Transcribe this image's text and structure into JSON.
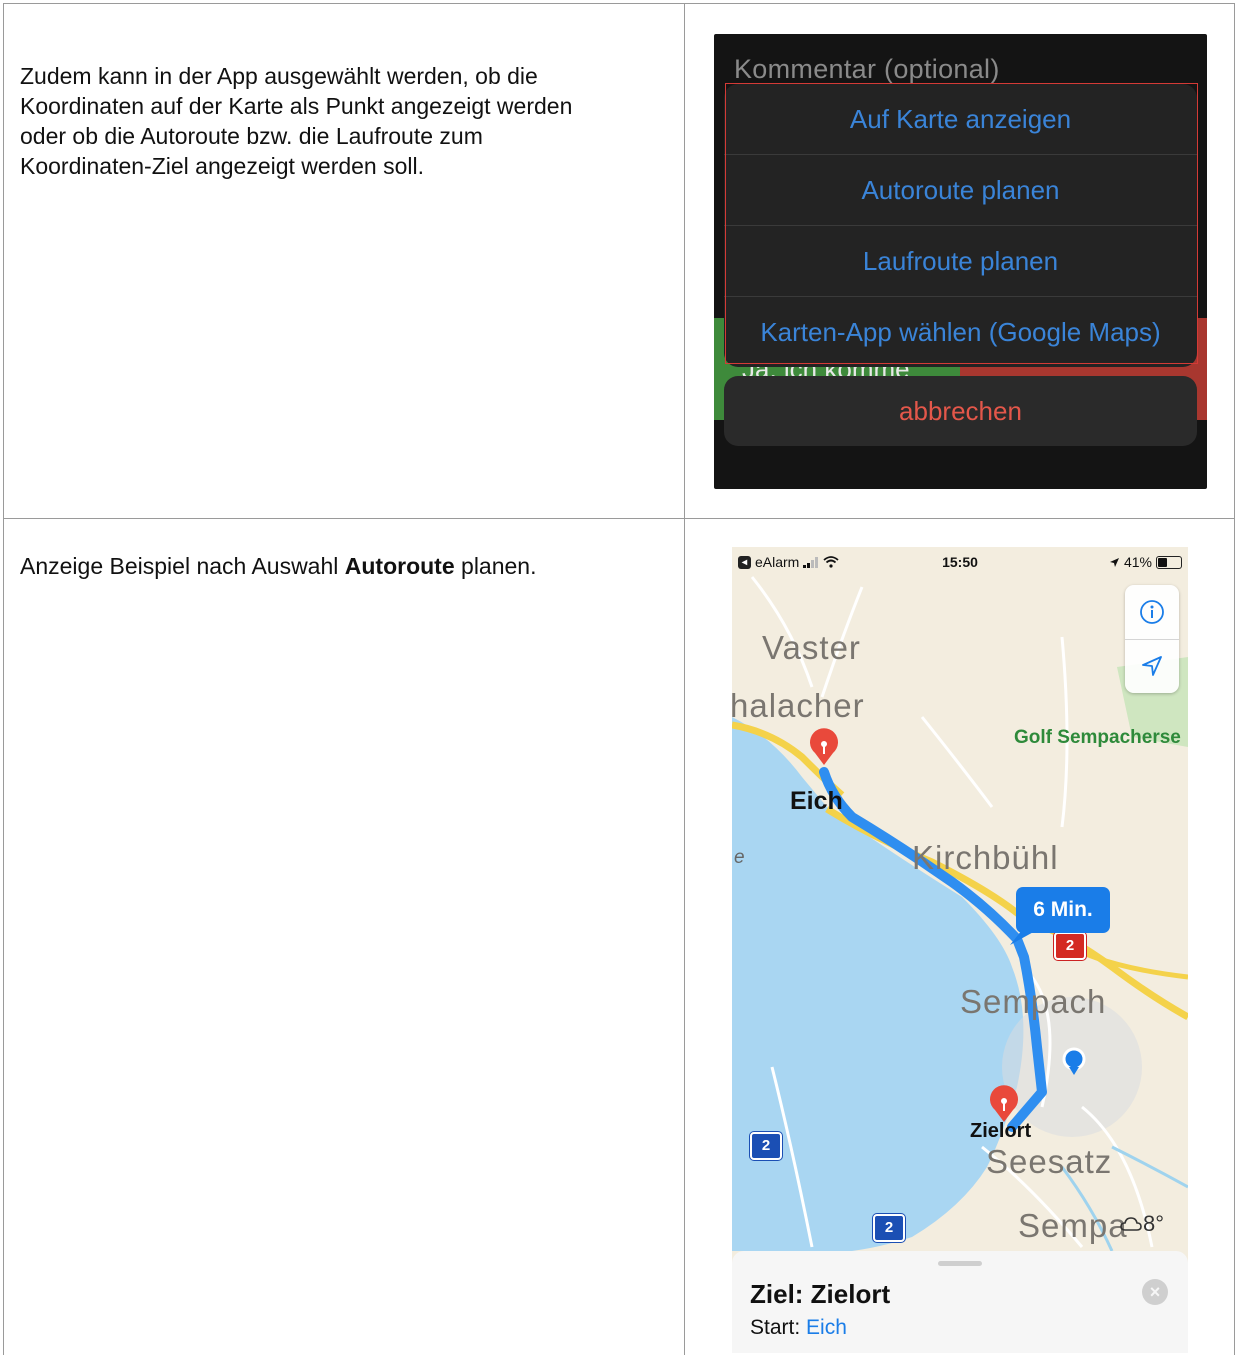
{
  "row1": {
    "description": "Zudem kann in der App ausgewählt werden, ob die Koordinaten auf der Karte als Punkt angezeigt werden oder ob die Autoroute bzw. die Laufroute zum Koordinaten-Ziel angezeigt werden soll.",
    "description_lines": [
      "Zudem kann in der App ausgewählt werden, ob die",
      "Koordinaten auf der Karte als Punkt angezeigt werden",
      "oder ob die Autoroute bzw. die Laufroute zum",
      "Koordinaten-Ziel angezeigt werden soll."
    ],
    "screenshot": {
      "comment_placeholder": "Kommentar (optional)",
      "background_button_text": "Ja, ich komme",
      "sheet_items": [
        "Auf Karte anzeigen",
        "Autoroute planen",
        "Laufroute planen",
        "Karten-App wählen (Google Maps)"
      ],
      "cancel_label": "abbrechen",
      "colors": {
        "sheet_text": "#3a84d8",
        "cancel_text": "#e4574a",
        "highlight_frame": "#d43a36"
      }
    }
  },
  "row2": {
    "text_before": "Anzeige Beispiel nach Auswahl ",
    "text_bold": "Autoroute",
    "text_after": " planen.",
    "screenshot": {
      "status_bar": {
        "carrier": "eAlarm",
        "time": "15:50",
        "battery": "41%",
        "battery_level": 0.41
      },
      "map_labels": {
        "town_1": "Vaster",
        "town_2": "halacher",
        "golf": "Golf Sempacherse",
        "start_pin": "Eich",
        "town_3": "Kirchbühl",
        "town_4": "Sempach",
        "dest_pin": "Zielort",
        "town_5": "Seesatz",
        "town_6": "Sempa",
        "lake_edge": "e"
      },
      "route_time": "6 Min.",
      "road_badges": [
        "2",
        "2",
        "2"
      ],
      "weather": "8°",
      "card": {
        "title": "Ziel: Zielort",
        "start_label": "Start: ",
        "start_value": "Eich"
      },
      "controls": [
        "info-icon",
        "location-arrow-icon"
      ],
      "colors": {
        "route": "#2f8ef0",
        "water": "#a9d6f2",
        "land": "#f3eddf",
        "pin": "#e9493b",
        "road_yellow": "#f4d24a"
      }
    }
  }
}
